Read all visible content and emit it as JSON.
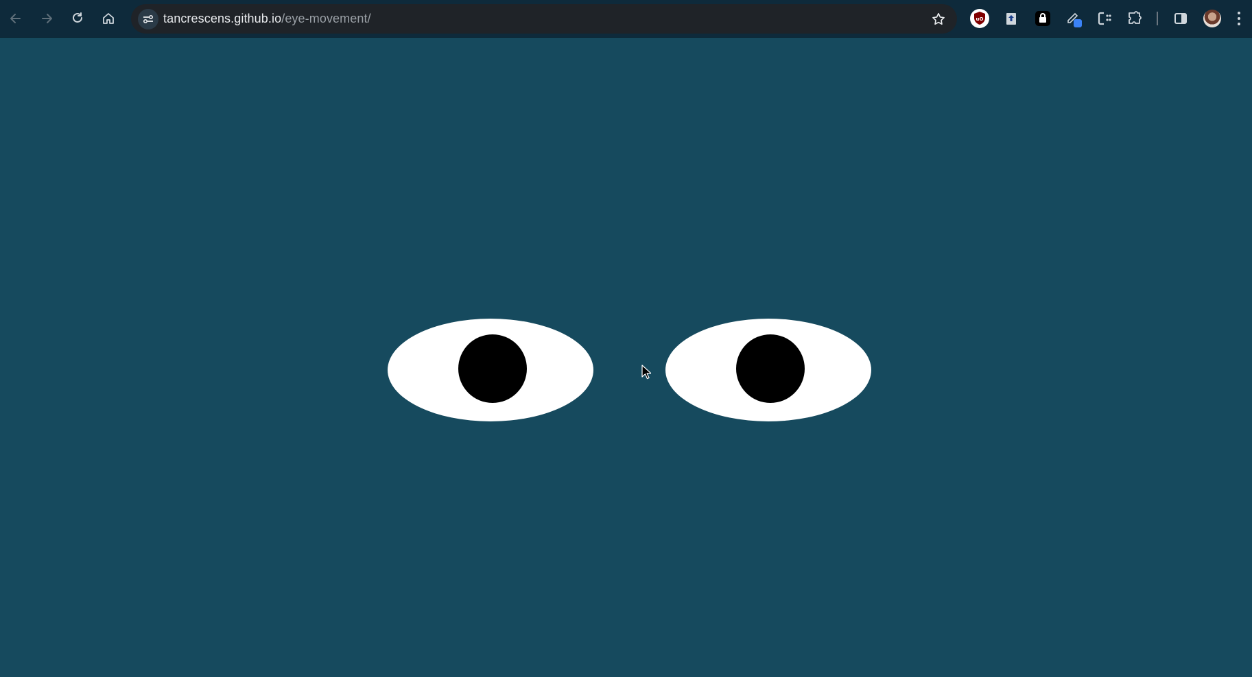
{
  "browser": {
    "url_host": "tancrescens.github.io",
    "url_path": "/eye-movement/",
    "nav_icons": [
      "back-arrow-icon",
      "forward-arrow-icon",
      "reload-icon",
      "home-icon"
    ],
    "omnibox_icons": [
      "site-info-icon",
      "bookmark-star-icon"
    ],
    "extension_icons": [
      "ublock-origin-icon",
      "upload-extension-icon",
      "lock-extension-icon",
      "pen-extension-icon",
      "css-extension-icon",
      "puzzle-extensions-icon"
    ],
    "right_icons": [
      "side-panel-icon",
      "profile-avatar",
      "kebab-menu-icon"
    ]
  },
  "page": {
    "background_color": "#164a5e",
    "eye_color": "#ffffff",
    "pupil_color": "#000000"
  }
}
